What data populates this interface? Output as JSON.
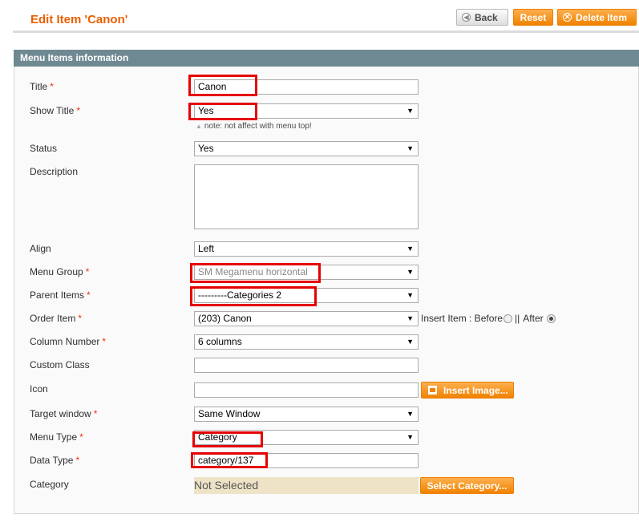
{
  "header": {
    "title": "Edit Item 'Canon'",
    "back_label": "Back",
    "reset_label": "Reset",
    "delete_label": "Delete Item"
  },
  "section": {
    "title": "Menu Items information"
  },
  "fields": {
    "title": {
      "label": "Title",
      "value": "Canon"
    },
    "show_title": {
      "label": "Show Title",
      "value": "Yes",
      "note": "note: not affect with menu top!"
    },
    "status": {
      "label": "Status",
      "value": "Yes"
    },
    "description": {
      "label": "Description",
      "value": ""
    },
    "align": {
      "label": "Align",
      "value": "Left"
    },
    "menu_group": {
      "label": "Menu Group",
      "value": "SM Megamenu horizontal"
    },
    "parent_items": {
      "label": "Parent Items",
      "value": "---------Categories 2"
    },
    "order_item": {
      "label": "Order Item",
      "value": "(203) Canon",
      "insert_label": "Insert Item : Before",
      "separator": "||",
      "after_label": "After"
    },
    "column_number": {
      "label": "Column Number",
      "value": "6 columns"
    },
    "custom_class": {
      "label": "Custom Class",
      "value": ""
    },
    "icon": {
      "label": "Icon",
      "value": "",
      "button_label": "Insert Image..."
    },
    "target_window": {
      "label": "Target window",
      "value": "Same Window"
    },
    "menu_type": {
      "label": "Menu Type",
      "value": "Category"
    },
    "data_type": {
      "label": "Data Type",
      "value": "category/137"
    },
    "category": {
      "label": "Category",
      "value": "Not Selected",
      "button_label": "Select Category..."
    }
  },
  "required_mark": "*",
  "icons": {
    "back": "back-arrow-icon",
    "delete": "delete-circle-icon",
    "image": "image-icon",
    "dropdown": "dropdown-arrow-icon",
    "note": "note-arrow-icon"
  },
  "colors": {
    "accent_orange": "#eb5e00",
    "button_orange": "#f18200",
    "section_header": "#6f8992",
    "highlight_red": "#e60000",
    "required_red": "#eb340a",
    "category_bg": "#eee3c7"
  }
}
